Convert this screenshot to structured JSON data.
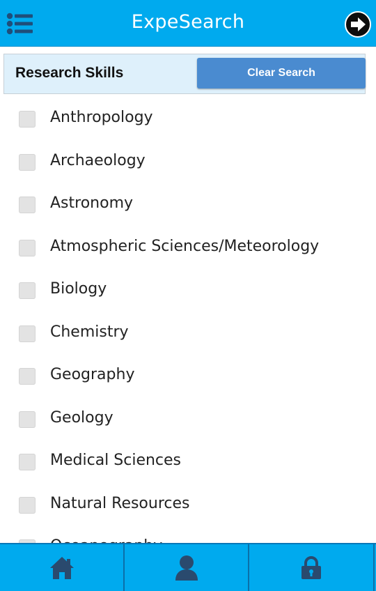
{
  "header": {
    "title": "ExpeSearch",
    "menu_icon": "list-menu-icon",
    "next_icon": "arrow-right-circle-icon"
  },
  "section": {
    "title": "Research Skills",
    "clear_label": "Clear Search"
  },
  "skills": [
    {
      "label": "Anthropology",
      "checked": false
    },
    {
      "label": "Archaeology",
      "checked": false
    },
    {
      "label": "Astronomy",
      "checked": false
    },
    {
      "label": "Atmospheric Sciences/Meteorology",
      "checked": false
    },
    {
      "label": "Biology",
      "checked": false
    },
    {
      "label": "Chemistry",
      "checked": false
    },
    {
      "label": "Geography",
      "checked": false
    },
    {
      "label": "Geology",
      "checked": false
    },
    {
      "label": "Medical Sciences",
      "checked": false
    },
    {
      "label": "Natural Resources",
      "checked": false
    },
    {
      "label": "Oceanography",
      "checked": false
    }
  ],
  "bottom_nav": [
    {
      "icon": "home-icon"
    },
    {
      "icon": "user-icon"
    },
    {
      "icon": "lock-icon"
    }
  ],
  "colors": {
    "bar": "#00aaee",
    "button": "#4a8bd0",
    "section_bg": "#def0fb"
  }
}
